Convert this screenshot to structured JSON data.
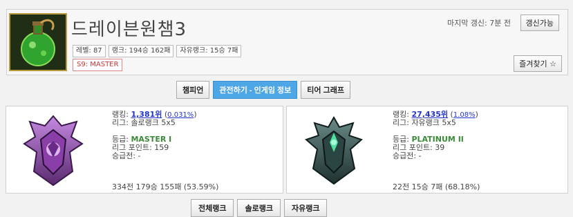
{
  "summoner": {
    "name": "드레이븐원챔3",
    "level_label": "레벨: 87",
    "rank_label": "랭크: 194승 162패",
    "flex_label": "자유랭크: 15승 7패",
    "tier_badge": "S9: MASTER"
  },
  "header": {
    "last_update": "마지막 갱신: 7분 전",
    "refresh_button": "갱신가능",
    "favorite_button": "즐겨찾기 ☆"
  },
  "tabs": [
    "챔피언",
    "관전하기 - 인게임 정보",
    "티어 그래프"
  ],
  "solo": {
    "ranking_label": "랭킹:",
    "ranking": "1,381위",
    "ranking_pct": "0.031%",
    "league_label": "리그: 솔로랭크 5x5",
    "tier_label": "등급:",
    "tier": "MASTER I",
    "lp_label": "리그 포인트: 159",
    "promo_label": "승급전: -",
    "record": "334전 179승 155패 (53.59%)"
  },
  "flex": {
    "ranking_label": "랭킹:",
    "ranking": "27,435위",
    "ranking_pct": "1.08%",
    "league_label": "리그: 자유랭크 5x5",
    "tier_label": "등급:",
    "tier": "PLATINUM II",
    "lp_label": "리그 포인트: 39",
    "promo_label": "승급전: -",
    "record": "22전 15승 7패 (68.18%)"
  },
  "bottom_tabs": [
    "전체랭크",
    "솔로랭크",
    "자유랭크"
  ],
  "colors": {
    "active_tab": "#4da6e6",
    "tier_text": "#3a8a3a",
    "link": "#2233cc",
    "badge_red": "#cc3333"
  }
}
